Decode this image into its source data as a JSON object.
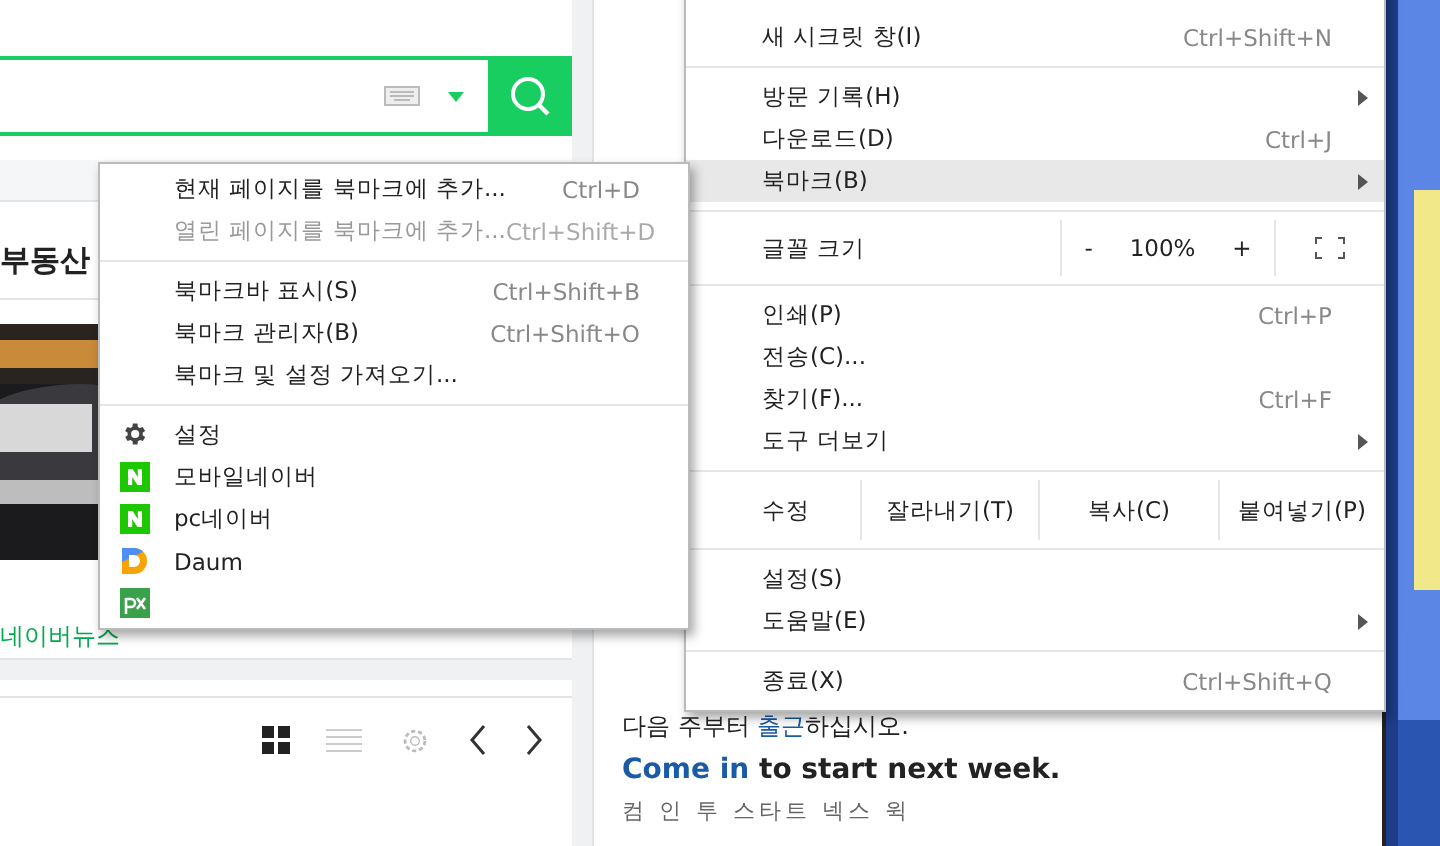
{
  "page": {
    "category_label": "부동산",
    "news_label": "네이버뉴스",
    "notice": {
      "text": "다음 주부터 **출근**하십시오.",
      "english": "*Come in* to start next week.",
      "reading": "컴 인 투 스타트 넥스 윅"
    }
  },
  "main_menu": {
    "items": [
      {
        "kind": "item",
        "label": "새 시크릿 창(I)",
        "shortcut": "Ctrl+Shift+N",
        "has_submenu": false,
        "highlighted": false
      },
      {
        "kind": "separator"
      },
      {
        "kind": "item",
        "label": "방문 기록(H)",
        "has_submenu": true,
        "highlighted": false
      },
      {
        "kind": "item",
        "label": "다운로드(D)",
        "shortcut": "Ctrl+J",
        "has_submenu": false,
        "highlighted": false
      },
      {
        "kind": "item",
        "label": "북마크(B)",
        "has_submenu": true,
        "highlighted": true
      },
      {
        "kind": "separator"
      },
      {
        "kind": "zoom",
        "label": "글꼴 크기",
        "minus": "-",
        "value": "100%",
        "plus": "+"
      },
      {
        "kind": "separator"
      },
      {
        "kind": "item",
        "label": "인쇄(P)",
        "shortcut": "Ctrl+P",
        "has_submenu": false,
        "highlighted": false
      },
      {
        "kind": "item",
        "label": "전송(C)...",
        "has_submenu": false,
        "highlighted": false
      },
      {
        "kind": "item",
        "label": "찾기(F)...",
        "shortcut": "Ctrl+F",
        "has_submenu": false,
        "highlighted": false
      },
      {
        "kind": "item",
        "label": "도구 더보기",
        "has_submenu": true,
        "highlighted": false
      },
      {
        "kind": "separator"
      },
      {
        "kind": "edit",
        "label": "수정",
        "buttons": [
          "잘라내기(T)",
          "복사(C)",
          "붙여넣기(P)"
        ]
      },
      {
        "kind": "separator"
      },
      {
        "kind": "item",
        "label": "설정(S)",
        "has_submenu": false,
        "highlighted": false
      },
      {
        "kind": "item",
        "label": "도움말(E)",
        "has_submenu": true,
        "highlighted": false
      },
      {
        "kind": "separator"
      },
      {
        "kind": "item",
        "label": "종료(X)",
        "shortcut": "Ctrl+Shift+Q",
        "has_submenu": false,
        "highlighted": false
      }
    ]
  },
  "bookmark_menu": {
    "items": [
      {
        "kind": "item",
        "label": "현재 페이지를 북마크에 추가...",
        "shortcut": "Ctrl+D",
        "disabled": false
      },
      {
        "kind": "item",
        "label": "열린 페이지를 북마크에 추가...",
        "shortcut": "Ctrl+Shift+D",
        "disabled": true
      },
      {
        "kind": "separator"
      },
      {
        "kind": "item",
        "label": "북마크바 표시(S)",
        "shortcut": "Ctrl+Shift+B",
        "disabled": false
      },
      {
        "kind": "item",
        "label": "북마크 관리자(B)",
        "shortcut": "Ctrl+Shift+O",
        "disabled": false
      },
      {
        "kind": "item",
        "label": "북마크 및 설정 가져오기...",
        "disabled": false
      },
      {
        "kind": "separator"
      },
      {
        "kind": "gear",
        "label": "설정"
      },
      {
        "kind": "n-logo",
        "label": "모바일네이버"
      },
      {
        "kind": "n-logo",
        "label": "pc네이버"
      },
      {
        "kind": "d-logo",
        "label": "Daum"
      },
      {
        "kind": "px-logo"
      }
    ]
  }
}
